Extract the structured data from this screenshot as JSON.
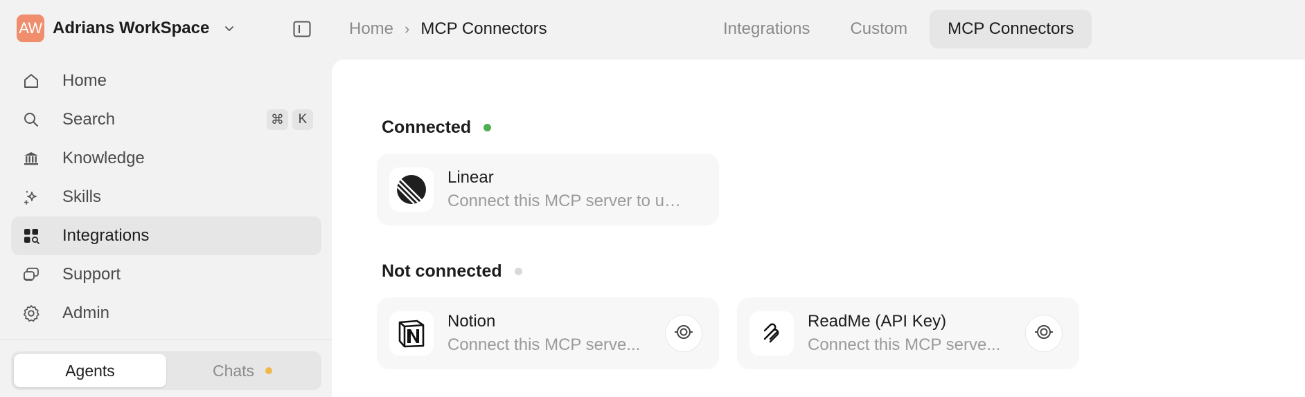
{
  "workspace": {
    "avatar_initials": "AW",
    "name": "Adrians WorkSpace",
    "avatar_color": "#ef8d6c"
  },
  "sidebar": {
    "items": [
      {
        "label": "Home",
        "icon": "home-icon"
      },
      {
        "label": "Search",
        "icon": "search-icon",
        "shortcut": [
          "⌘",
          "K"
        ]
      },
      {
        "label": "Knowledge",
        "icon": "library-icon"
      },
      {
        "label": "Skills",
        "icon": "sparkle-icon"
      },
      {
        "label": "Integrations",
        "icon": "grid-search-icon",
        "active": true
      },
      {
        "label": "Support",
        "icon": "chat-bubbles-icon"
      },
      {
        "label": "Admin",
        "icon": "gear-icon"
      }
    ],
    "segment": {
      "agents_label": "Agents",
      "chats_label": "Chats",
      "active": "Agents",
      "chats_dot_color": "#f0b84a"
    }
  },
  "breadcrumb": {
    "home": "Home",
    "separator": "›",
    "current": "MCP Connectors"
  },
  "tabs": [
    {
      "label": "Integrations",
      "active": false
    },
    {
      "label": "Custom",
      "active": false
    },
    {
      "label": "MCP Connectors",
      "active": true
    }
  ],
  "main": {
    "connected": {
      "title": "Connected",
      "dot_color": "#4caf50",
      "cards": [
        {
          "name": "Linear",
          "description": "Connect this MCP server to us...",
          "icon": "linear-logo-icon"
        }
      ]
    },
    "not_connected": {
      "title": "Not connected",
      "dot_color": "#d9d9d9",
      "cards": [
        {
          "name": "Notion",
          "description": "Connect this MCP serve...",
          "icon": "notion-logo-icon",
          "action_icon": "connect-icon"
        },
        {
          "name": "ReadMe (API Key)",
          "description": "Connect this MCP serve...",
          "icon": "readme-logo-icon",
          "action_icon": "connect-icon"
        }
      ]
    }
  }
}
